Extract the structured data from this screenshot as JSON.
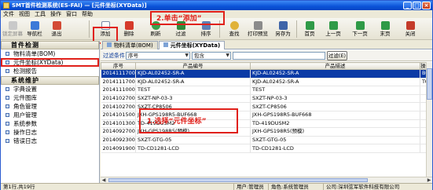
{
  "window": {
    "title": "SMT首件检测系统(ES-FAI) — [元件坐标(XYData)]",
    "minimize": "_",
    "maximize": "□",
    "close": "×"
  },
  "menu": [
    "文件",
    "视图",
    "工具",
    "操作",
    "窗口",
    "帮助"
  ],
  "toolbar": {
    "lock": "锁定屏幕",
    "nav": "导航栏",
    "exit": "退出",
    "add": "添加",
    "delete": "删除",
    "refresh": "刷新",
    "filter": "过滤",
    "sort": "排序",
    "find": "查找",
    "print_preview": "打印预览",
    "save_as": "另存为",
    "first": "首页",
    "prev": "上一页",
    "next": "下一页",
    "last": "末页",
    "close": "关闭"
  },
  "callouts": {
    "add": "2.单击“添加”",
    "select": "1.选择“元件坐标”"
  },
  "left_nav": {
    "section1": "首件检测",
    "group1": [
      "物料清单(BOM)",
      "元件坐标(XYData)",
      "检测报告"
    ],
    "section2": "系统维护",
    "group2": [
      "字典设置",
      "元件图库",
      "角色管理",
      "用户管理",
      "系统参数",
      "操作日志",
      "错误日志"
    ]
  },
  "tabs": [
    "物料清单(BOM)",
    "元件坐标(XYData)"
  ],
  "filter": {
    "label": "过滤条件",
    "field": "序号",
    "op": "包含",
    "value": "",
    "button": "过滤(E)"
  },
  "grid": {
    "columns": [
      "序号",
      "产品编号",
      "产品描述",
      "操"
    ],
    "rows": [
      [
        "20141117003",
        "KJD-AL02452-SR-A",
        "KJD-AL02452-SR-A",
        "BO"
      ],
      [
        "20141117002",
        "KJD-AL02452-SR-A",
        "KJD-AL02452-SR-A",
        "TC"
      ],
      [
        "20141110001",
        "TEST",
        "TEST",
        ""
      ],
      [
        "20141027002",
        "SXZT-NP-03-3",
        "SXZT-NP-03-3",
        ""
      ],
      [
        "20141027001",
        "SXZT-CP8506",
        "SXZT-CP8506",
        ""
      ],
      [
        "20141015001",
        "JXH-GPS198R5-BUF668",
        "JXH-GPS198R5-BUF668",
        ""
      ],
      [
        "20141013001",
        "TD-419DUSM2",
        "TD-419DUSM2",
        ""
      ],
      [
        "20140927001",
        "JXH-GPS198R5(预模)",
        "JXH-GPS198R5(预模)",
        ""
      ],
      [
        "20140923001",
        "SXZT-GTG-05",
        "SXZT-GTG-05",
        ""
      ],
      [
        "20140919001",
        "TD-CD1281-LCD",
        "TD-CD1281-LCD",
        ""
      ]
    ]
  },
  "status": {
    "row_info": "第1行,共19行",
    "user": "用户:管理员",
    "role": "角色:系统管理员",
    "company": "公司:深圳弦军软件科技有限公司"
  },
  "colors": {
    "accent": "#0b3ba6",
    "callout": "#e0201a",
    "titlebar": "#0a52d8"
  }
}
